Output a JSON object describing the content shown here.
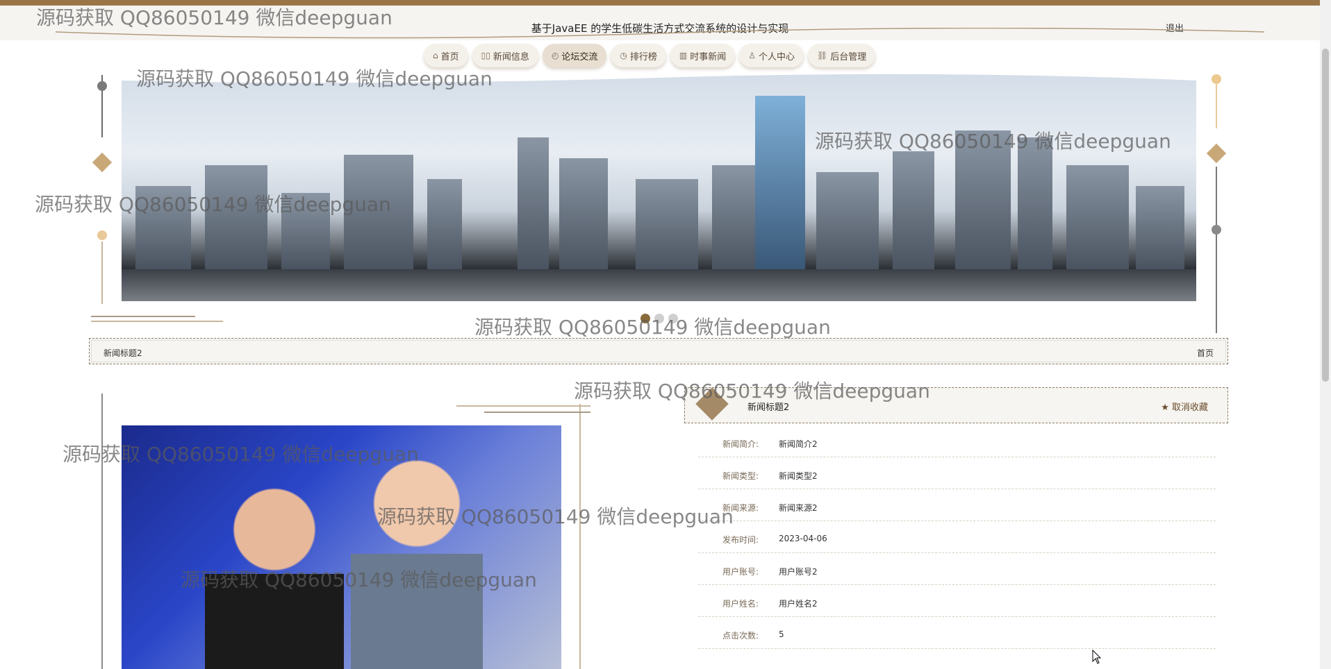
{
  "header": {
    "title": "基于JavaEE 的学生低碳生活方式交流系统的设计与实现",
    "logout_label": "退出"
  },
  "nav": {
    "items": [
      {
        "label": "首页",
        "icon": "home-icon",
        "glyph": "⌂"
      },
      {
        "label": "新闻信息",
        "icon": "news-icon",
        "glyph": "▯▯"
      },
      {
        "label": "论坛交流",
        "icon": "forum-icon",
        "glyph": "◴",
        "active": true
      },
      {
        "label": "排行榜",
        "icon": "clock-icon",
        "glyph": "◷"
      },
      {
        "label": "时事新闻",
        "icon": "building-icon",
        "glyph": "▥"
      },
      {
        "label": "个人中心",
        "icon": "user-icon",
        "glyph": "♙"
      },
      {
        "label": "后台管理",
        "icon": "link-icon",
        "glyph": "⛓"
      }
    ]
  },
  "carousel": {
    "slide_count": 3,
    "active_index": 0
  },
  "breadcrumb": {
    "current": "新闻标题2",
    "home_link": "首页"
  },
  "detail": {
    "title": "新闻标题2",
    "favorite_label": "取消收藏",
    "favorite_icon": "star-icon",
    "fields": [
      {
        "label": "新闻简介:",
        "value": "新闻简介2"
      },
      {
        "label": "新闻类型:",
        "value": "新闻类型2"
      },
      {
        "label": "新闻来源:",
        "value": "新闻来源2"
      },
      {
        "label": "发布时间:",
        "value": "2023-04-06"
      },
      {
        "label": "用户账号:",
        "value": "用户账号2"
      },
      {
        "label": "用户姓名:",
        "value": "用户姓名2"
      },
      {
        "label": "点击次数:",
        "value": "5"
      }
    ]
  },
  "watermarks": [
    "源码获取 QQ86050149 微信deepguan",
    "源码获取 QQ86050149 微信deepguan",
    "源码获取 QQ86050149 微信deepguan",
    "源码获取 QQ86050149 微信deepguan",
    "源码获取 QQ86050149 微信deepguan",
    "源码获取 QQ86050149 微信deepguan",
    "源码获取 QQ86050149 微信deepguan",
    "源码获取 QQ86050149 微信deepguan",
    "源码获取 QQ86050149 微信deepguan"
  ],
  "colors": {
    "accent": "#9a7548",
    "panel": "#f7f5f1",
    "deco": "#c8b79c"
  }
}
